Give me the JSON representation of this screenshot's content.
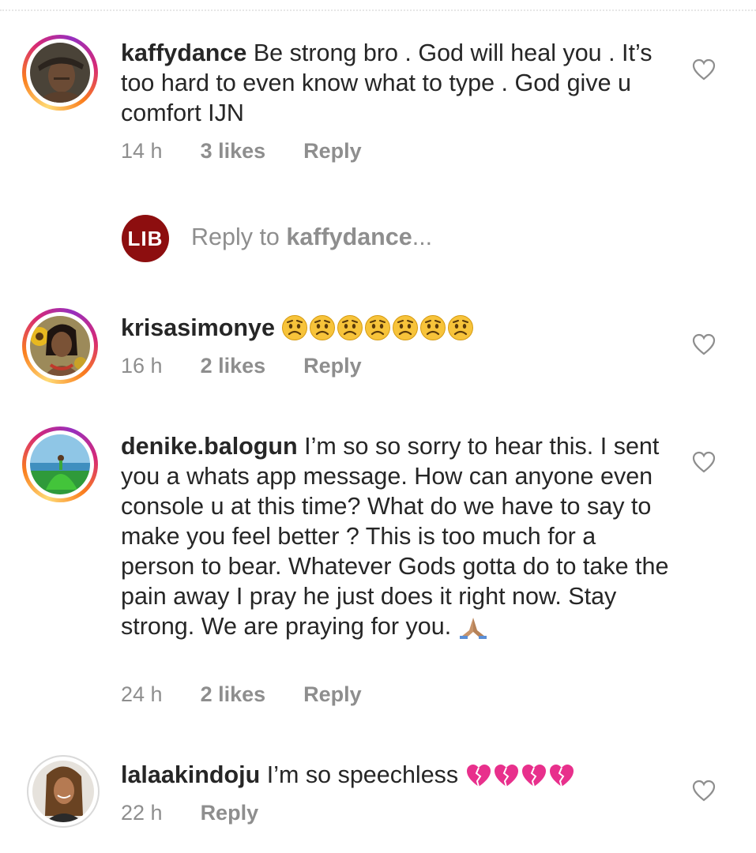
{
  "comments": [
    {
      "username": "kaffydance",
      "text": " Be strong bro . God will heal you . It’s too hard to even know what to type . God give u comfort IJN",
      "time": "14 h",
      "likes": "3 likes",
      "reply": "Reply",
      "avatar_icon": "person-photo",
      "emoji": ""
    },
    {
      "username": "krisasimonye",
      "text": " ",
      "time": "16 h",
      "likes": "2 likes",
      "reply": "Reply",
      "avatar_icon": "person-photo",
      "emoji": "😟😟😟😟😟😟😟"
    },
    {
      "username": "denike.balogun",
      "text": " I’m so so sorry to hear this. I sent you a whats app message. How can anyone even console u at this time? What do we have to say to make you feel better ? This is too much for a person to bear. Whatever Gods gotta do to take the pain away I pray he just does it right now. Stay strong. We are praying for you. ",
      "time": "24 h",
      "likes": "2 likes",
      "reply": "Reply",
      "avatar_icon": "person-photo",
      "emoji": "🙏🏽"
    },
    {
      "username": "lalaakindoju",
      "text": " I’m so speechless ",
      "time": "22 h",
      "likes": "",
      "reply": "Reply",
      "avatar_icon": "person-photo",
      "emoji": "💔💔💔💔"
    }
  ],
  "reply_box": {
    "logo_text": "LIB",
    "placeholder_prefix": "Reply to ",
    "placeholder_user": "kaffydance",
    "placeholder_suffix": "..."
  },
  "icons": {
    "like": "heart-outline-icon"
  },
  "colors": {
    "text": "#262626",
    "muted": "#8e8e8e",
    "lib_brand": "#8d0e0f",
    "story_ring": [
      "#feda75",
      "#fa7e1e",
      "#d62976",
      "#962fbf"
    ],
    "broken_heart": "#e8308c",
    "worried_face": "#f7c33a"
  }
}
